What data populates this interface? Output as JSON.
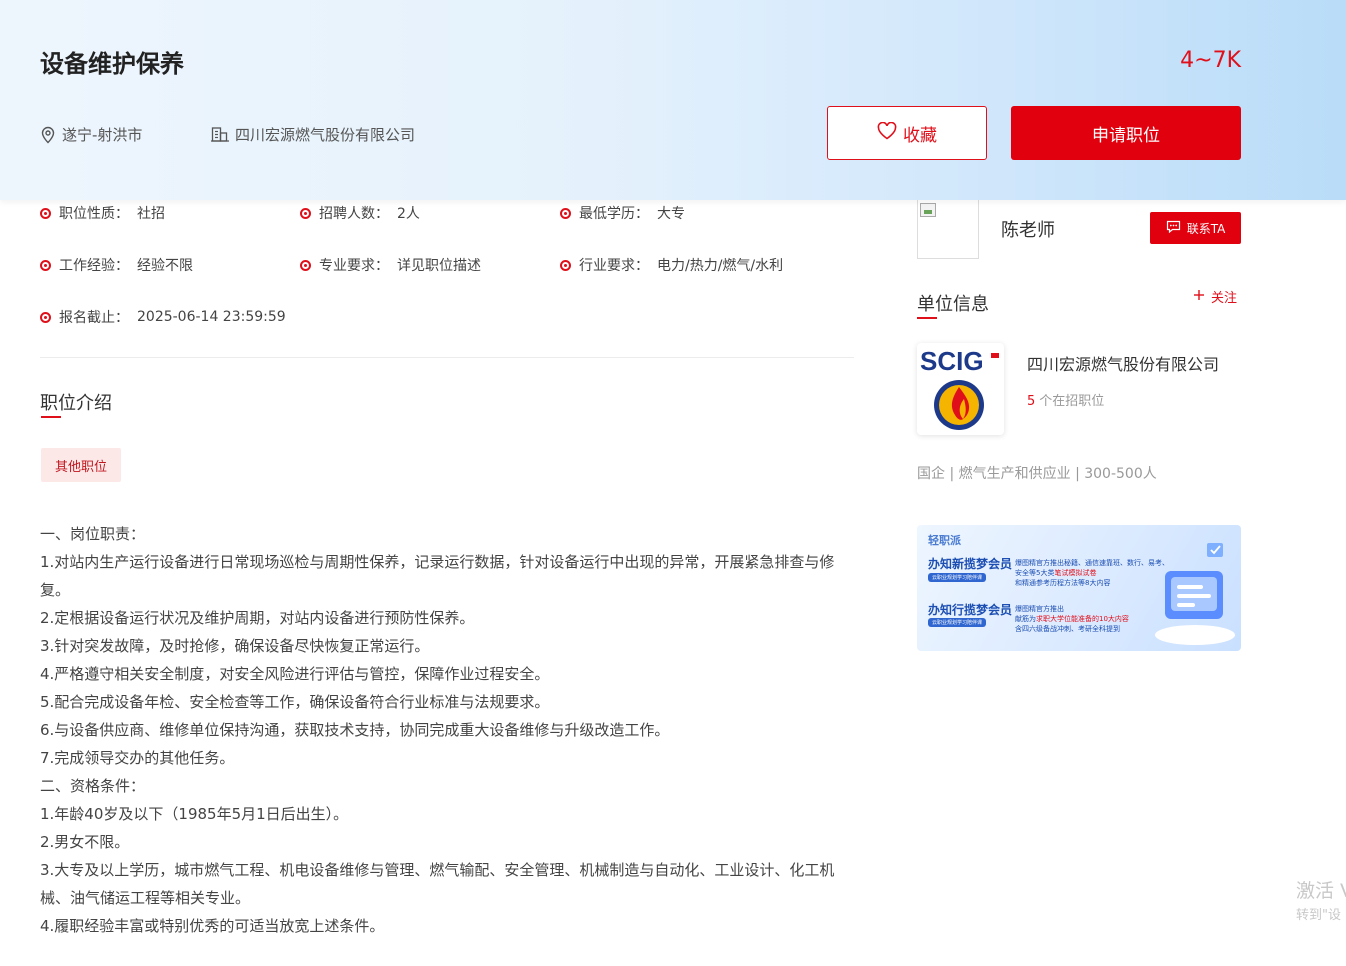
{
  "job": {
    "title": "设备维护保养",
    "salary": "4~7K",
    "location": "遂宁-射洪市",
    "company": "四川宏源燃气股份有限公司",
    "favorite_label": "收藏",
    "apply_label": "申请职位"
  },
  "attributes": [
    {
      "key": "职位性质：",
      "value": "社招"
    },
    {
      "key": "招聘人数：",
      "value": "2人"
    },
    {
      "key": "最低学历：",
      "value": "大专"
    },
    {
      "key": "工作经验：",
      "value": "经验不限"
    },
    {
      "key": "专业要求：",
      "value": "详见职位描述"
    },
    {
      "key": "行业要求：",
      "value": "电力/热力/燃气/水利"
    },
    {
      "key": "报名截止：",
      "value": "2025-06-14 23:59:59"
    }
  ],
  "description": {
    "section_title": "职位介绍",
    "tag": "其他职位",
    "lines": [
      "一、岗位职责：",
      "1.对站内生产运行设备进行日常现场巡检与周期性保养，记录运行数据，针对设备运行中出现的异常，开展紧急排查与修复。",
      "2.定根据设备运行状况及维护周期，对站内设备进行预防性保养。",
      "3.针对突发故障，及时抢修，确保设备尽快恢复正常运行。",
      "4.严格遵守相关安全制度，对安全风险进行评估与管控，保障作业过程安全。",
      "5.配合完成设备年检、安全检查等工作，确保设备符合行业标准与法规要求。",
      "6.与设备供应商、维修单位保持沟通，获取技术支持，协同完成重大设备维修与升级改造工作。",
      "7.完成领导交办的其他任务。",
      "二、资格条件：",
      "1.年龄40岁及以下（1985年5月1日后出生）。",
      "2.男女不限。",
      "3.大专及以上学历，城市燃气工程、机电设备维修与管理、燃气输配、安全管理、机械制造与自动化、工业设计、化工机械、油气储运工程等相关专业。",
      "4.履职经验丰富或特别优秀的可适当放宽上述条件。"
    ]
  },
  "sidebar": {
    "recruiter_name": "陈老师",
    "contact_label": "联系TA",
    "unit_title": "单位信息",
    "follow_label": "关注",
    "logo_text": "SCIG",
    "company_name": "四川宏源燃气股份有限公司",
    "jobs_count": "5",
    "jobs_suffix": "个在招职位",
    "company_info": "国企 | 燃气生产和供应业 | 300-500人"
  },
  "banner": {
    "brand": "轻职派",
    "line1_title": "办知新揽梦会员",
    "line1_sub": "云职业规划学习陪伴课",
    "line1_text_a": "爆图精官方推出秘籍、通信速靠班、数行、易考、",
    "line1_text_b": "安全等5大类",
    "line1_text_b_hl": "笔试模拟试卷",
    "line1_text_c": "和精通参考历程方法等8大内容",
    "line2_title": "办知行揽梦会员",
    "line2_sub": "云职业规划学习陪伴课",
    "line2_text_a": "爆图精官方推出",
    "line2_text_b": "献筋为",
    "line2_text_b_hl": "求职大学位能准备的10大内容",
    "line2_text_c": "含四六级备战冲刺、考研全科提到"
  },
  "watermark": {
    "line1": "激活 V",
    "line2": "转到\"设"
  },
  "colors": {
    "accent": "#e0101b",
    "apply_bg": "#e0000e",
    "header_gradient_end": "#b9dcf8"
  }
}
